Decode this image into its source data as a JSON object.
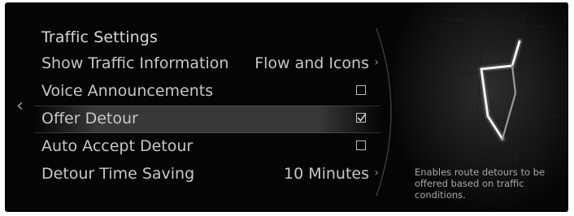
{
  "screen": {
    "title": "Traffic Settings",
    "back_icon": "chevron-left-icon"
  },
  "settings": [
    {
      "label": "Show Traffic Information",
      "value": "Flow and Icons",
      "control": "chevron-right-icon"
    },
    {
      "label": "Voice Announcements",
      "checked": false,
      "control": "checkbox"
    },
    {
      "label": "Offer Detour",
      "checked": true,
      "control": "checkbox",
      "highlighted": true
    },
    {
      "label": "Auto Accept Detour",
      "checked": false,
      "control": "checkbox"
    },
    {
      "label": "Detour Time Saving",
      "value": "10 Minutes",
      "control": "chevron-right-icon"
    }
  ],
  "help": {
    "description": "Enables route detours to be offered based on traffic conditions."
  },
  "colors": {
    "background": "#050505",
    "text": "#c7c7c7",
    "route_line": "#ffffff"
  }
}
